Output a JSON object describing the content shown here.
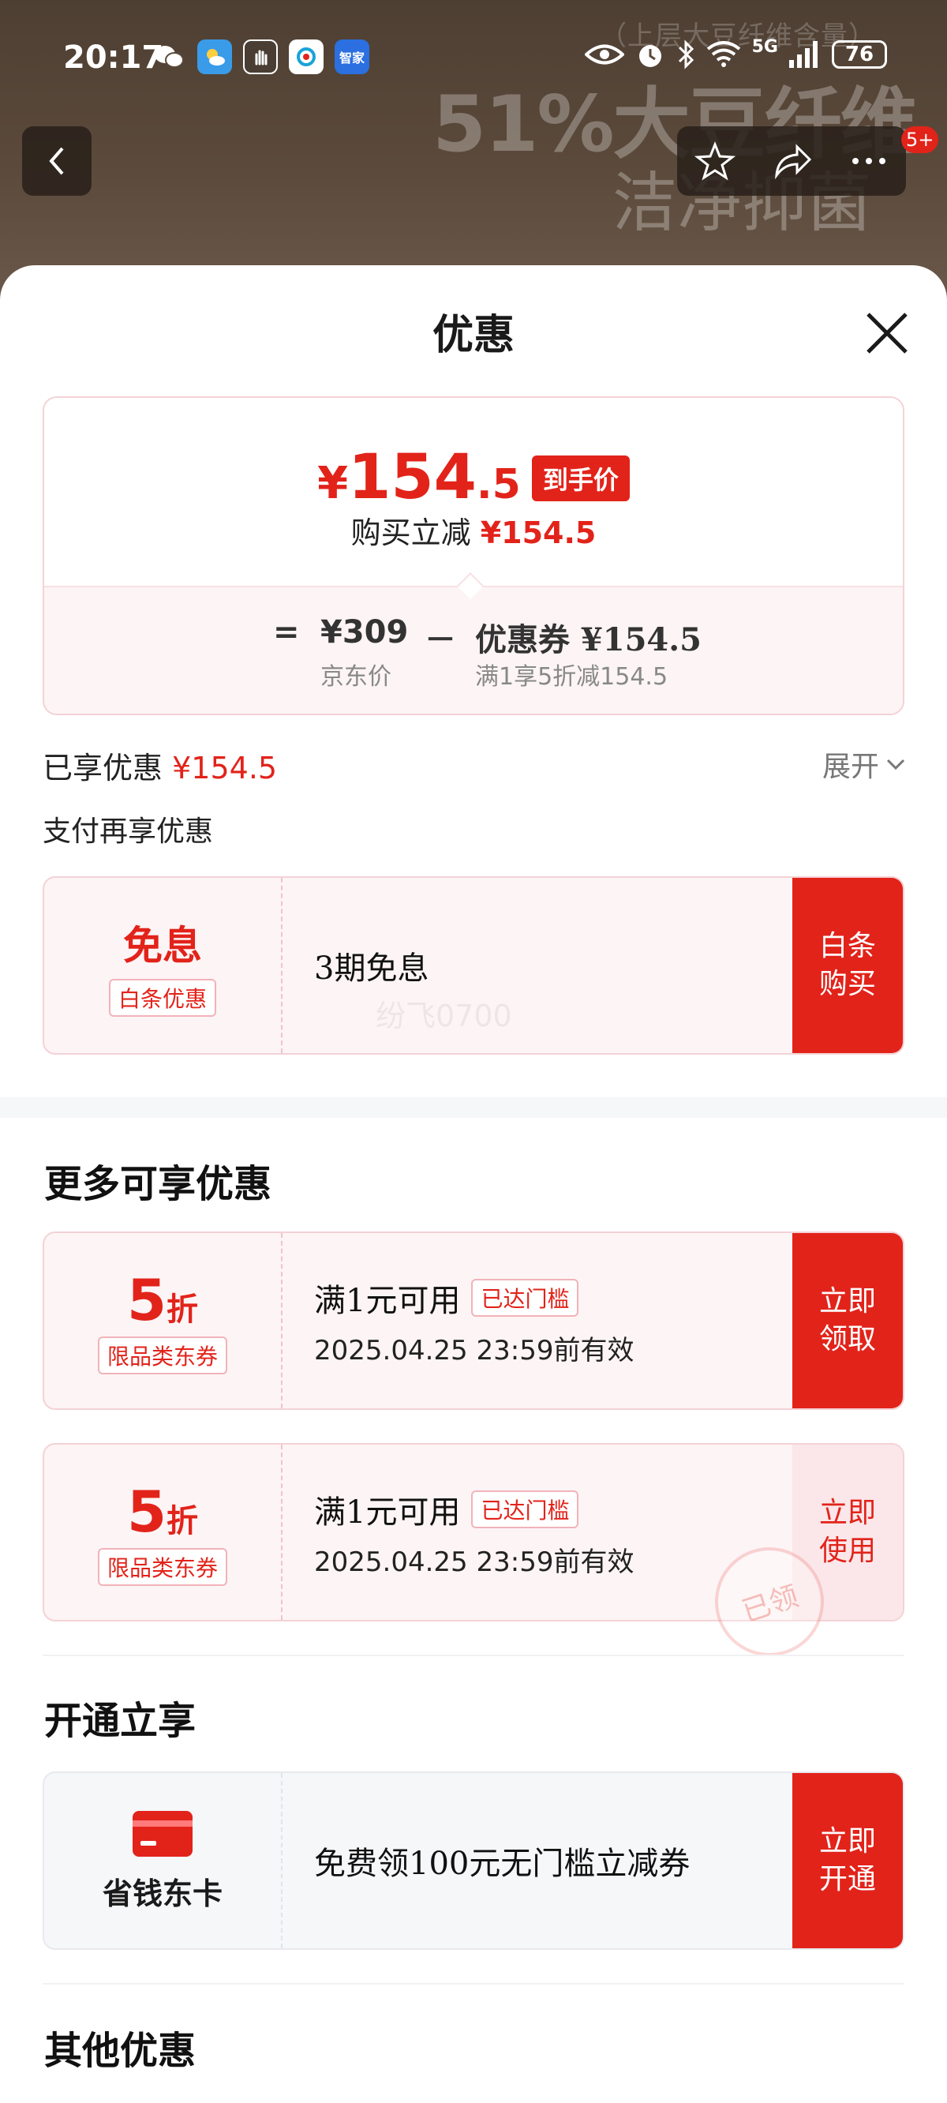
{
  "status_bar": {
    "time": "20:17",
    "signal_label": "5G",
    "battery": "76"
  },
  "backdrop": {
    "promo_small": "（上层大豆纤维含量）",
    "promo_main": "51%大豆纤维",
    "promo_sub": "洁净抑菌"
  },
  "nav": {
    "badge": "5+"
  },
  "sheet": {
    "title": "优惠"
  },
  "price_card": {
    "yen": "¥",
    "price_int": "154",
    "price_dec": ".5",
    "price_tag": "到手价",
    "reduce_label": "购买立减",
    "reduce_value": "¥154.5",
    "equals": "=",
    "jd_price": "¥309",
    "jd_price_label": "京东价",
    "minus": "－",
    "coupon_label": "优惠券 ¥154.5",
    "coupon_note": "满1享5折减154.5"
  },
  "enjoyed": {
    "label": "已享优惠",
    "value": "¥154.5",
    "expand": "展开"
  },
  "pay_more": {
    "title": "支付再享优惠",
    "card": {
      "big": "免息",
      "tag": "白条优惠",
      "desc": "3期免息",
      "watermark": "纷飞0700",
      "action": "白条\n购买"
    }
  },
  "more": {
    "title": "更多可享优惠",
    "coupons": [
      {
        "discount_num": "5",
        "discount_unit": "折",
        "tag": "限品类东券",
        "title": "满1元可用",
        "badge": "已达门槛",
        "expire": "2025.04.25 23:59前有效",
        "action": "立即\n领取"
      },
      {
        "discount_num": "5",
        "discount_unit": "折",
        "tag": "限品类东券",
        "title": "满1元可用",
        "badge": "已达门槛",
        "expire": "2025.04.25 23:59前有效",
        "action": "立即\n使用",
        "stamp": "已领"
      }
    ]
  },
  "open": {
    "title": "开通立享",
    "card": {
      "name": "省钱东卡",
      "desc": "免费领100元无门槛立减券",
      "action": "立即\n开通"
    }
  },
  "other": {
    "title": "其他优惠"
  },
  "colors": {
    "accent": "#e2231a",
    "card_bg": "#fdf4f5"
  }
}
